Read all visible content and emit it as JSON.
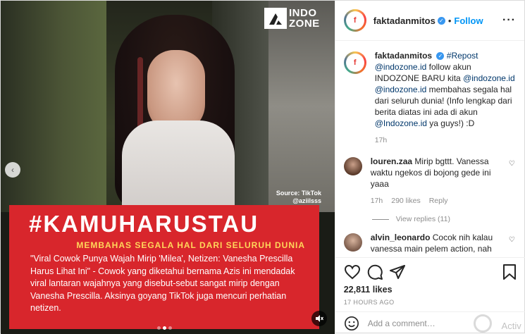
{
  "media": {
    "logo": {
      "line1": "INDO",
      "line2": "ZONE"
    },
    "source": {
      "line1": "Source: TikTok",
      "line2": "@aziilsss"
    },
    "headline": "#KAMUHARUSTAU",
    "subhead": "MEMBAHAS SEGALA HAL DARI SELURUH DUNIA",
    "excerpt": "\"Viral Cowok Punya Wajah Mirip 'Milea', Netizen: Vanesha Prescilla Harus Lihat Ini\" - Cowok yang diketahui bernama Azis ini mendadak viral lantaran wajahnya yang disebut-sebut sangat mirip dengan Vanesha Prescilla. Aksinya goyang TikTok juga mencuri perhatian netizen.",
    "prev_arrow": "‹",
    "carousel_dots": 3,
    "active_dot": 1
  },
  "header": {
    "username": "faktadanmitos",
    "separator": "•",
    "follow": "Follow",
    "more": "···"
  },
  "caption": {
    "username": "faktadanmitos",
    "repost_tag": "#Repost",
    "mention1": "@indozone.id",
    "text1": " follow akun INDOZONE BARU kita ",
    "mention2": "@indozone.id",
    "mention3": "@indozone.id",
    "text2": " membahas segala hal dari seluruh dunia! (Info lengkap dari berita diatas ini ada di akun ",
    "mention4": "@Indozone.id",
    "text3": " ya guys!) :D",
    "time": "17h"
  },
  "comments": [
    {
      "username": "louren.zaa",
      "text": "Mirip bgttt. Vanessa waktu ngekos di bojong gede ini yaaa",
      "time": "17h",
      "likes": "290 likes",
      "reply": "Reply",
      "view_replies": "View replies (11)"
    },
    {
      "username": "alvin_leonardo",
      "text": "Cocok nih kalau vanessa main pelem action, nah"
    }
  ],
  "actions": {
    "likes": "22,811 likes",
    "time_ago": "17 HOURS AGO"
  },
  "add_comment": {
    "placeholder": "Add a comment…",
    "watermark": "Activ"
  },
  "colors": {
    "accent": "#0095f6",
    "panel_red": "#d8262c",
    "subhead_yellow": "#ffd65a"
  },
  "icons": [
    "heart-icon",
    "comment-icon",
    "share-icon",
    "bookmark-icon",
    "emoji-icon",
    "verified-icon",
    "mute-icon",
    "chevron-left-icon"
  ]
}
